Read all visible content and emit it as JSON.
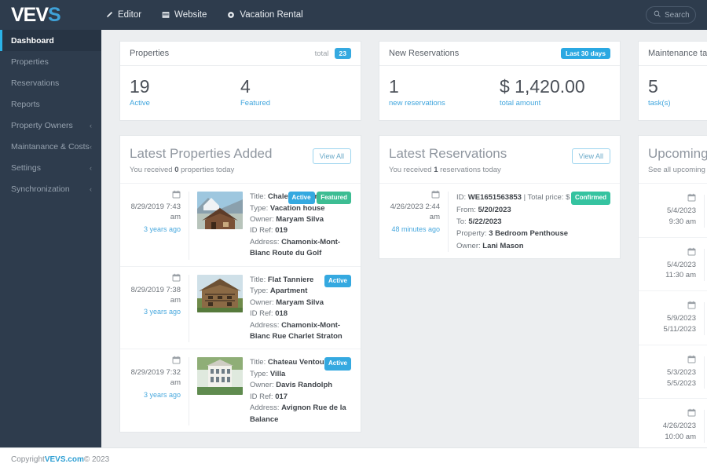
{
  "topbar": {
    "logo_main": "VEV",
    "logo_accent": "S",
    "nav": [
      {
        "label": "Editor",
        "icon": "pencil-icon"
      },
      {
        "label": "Website",
        "icon": "window-icon"
      },
      {
        "label": "Vacation Rental",
        "icon": "gear-icon"
      }
    ],
    "search_placeholder": "Search"
  },
  "sidebar": {
    "items": [
      {
        "label": "Dashboard",
        "active": true,
        "expandable": false
      },
      {
        "label": "Properties",
        "active": false,
        "expandable": false
      },
      {
        "label": "Reservations",
        "active": false,
        "expandable": false
      },
      {
        "label": "Reports",
        "active": false,
        "expandable": false
      },
      {
        "label": "Property Owners",
        "active": false,
        "expandable": true
      },
      {
        "label": "Maintanance & Costs",
        "active": false,
        "expandable": true
      },
      {
        "label": "Settings",
        "active": false,
        "expandable": true
      },
      {
        "label": "Synchronization",
        "active": false,
        "expandable": true
      }
    ],
    "caret": "‹"
  },
  "cards": {
    "properties": {
      "title": "Properties",
      "total_label": "total",
      "total_value": "23",
      "stats": [
        {
          "num": "19",
          "label": "Active"
        },
        {
          "num": "4",
          "label": "Featured"
        }
      ]
    },
    "reservations": {
      "title": "New Reservations",
      "badge": "Last 30 days",
      "stats": [
        {
          "num": "1",
          "label": "new reservations"
        },
        {
          "num": "$ 1,420.00",
          "label": "total amount"
        }
      ]
    },
    "maintenance": {
      "title": "Maintenance tasks",
      "stats": [
        {
          "num": "5",
          "label": "task(s)"
        }
      ]
    }
  },
  "properties_panel": {
    "title": "Latest Properties Added",
    "subtitle_pre": "You received ",
    "subtitle_count": "0",
    "subtitle_post": " properties today",
    "view_all": "View All",
    "labels": {
      "title": "Title:",
      "type": "Type:",
      "owner": "Owner:",
      "id_ref": "ID Ref:",
      "address": "Address:"
    },
    "rows": [
      {
        "date": "8/29/2019 7:43 am",
        "ago": "3 years ago",
        "title": "Chalet Lumiere",
        "type": "Vacation house",
        "owner": "Maryam Silva",
        "id_ref": "019",
        "address": "Chamonix-Mont-Blanc Route du Golf",
        "tags": [
          "Active",
          "Featured"
        ]
      },
      {
        "date": "8/29/2019 7:38 am",
        "ago": "3 years ago",
        "title": "Flat Tanniere",
        "type": "Apartment",
        "owner": "Maryam Silva",
        "id_ref": "018",
        "address": "Chamonix-Mont-Blanc Rue Charlet Straton",
        "tags": [
          "Active"
        ]
      },
      {
        "date": "8/29/2019 7:32 am",
        "ago": "3 years ago",
        "title": "Chateau Ventoux",
        "type": "Villa",
        "owner": "Davis Randolph",
        "id_ref": "017",
        "address": "Avignon Rue de la Balance",
        "tags": [
          "Active"
        ]
      }
    ]
  },
  "reservations_panel": {
    "title": "Latest Reservations",
    "subtitle_pre": "You received ",
    "subtitle_count": "1",
    "subtitle_post": " reservations today",
    "view_all": "View All",
    "labels": {
      "id": "ID:",
      "total_price": "Total price:",
      "from": "From:",
      "to": "To:",
      "property": "Property:",
      "owner": "Owner:"
    },
    "rows": [
      {
        "date": "4/26/2023 2:44 am",
        "ago": "48 minutes ago",
        "id": "WE1651563853",
        "total_price": "$ 1,420.00",
        "from": "5/20/2023",
        "to": "5/22/2023",
        "property": "3 Bedroom Penthouse",
        "owner": "Lani Mason",
        "status": "Confirmed"
      }
    ]
  },
  "tasks_panel": {
    "title": "Upcoming tasks",
    "subtitle": "See all upcoming tasks for all",
    "rows": [
      {
        "date_line1": "5/4/2023",
        "date_line2": "9:30 am"
      },
      {
        "date_line1": "5/4/2023",
        "date_line2": "11:30 am"
      },
      {
        "date_line1": "5/9/2023",
        "date_line2": "5/11/2023"
      },
      {
        "date_line1": "5/3/2023",
        "date_line2": "5/5/2023"
      },
      {
        "date_line1": "4/26/2023",
        "date_line2": "10:00 am"
      }
    ]
  },
  "footer": {
    "copyright_pre": "Copyright ",
    "brand": "VEVS.com",
    "copyright_post": " © 2023"
  },
  "colors": {
    "sidebar": "#2e3c4d",
    "accent_blue": "#35a9e0",
    "accent_green": "#3dbd93",
    "page_bg": "#eceef0"
  }
}
